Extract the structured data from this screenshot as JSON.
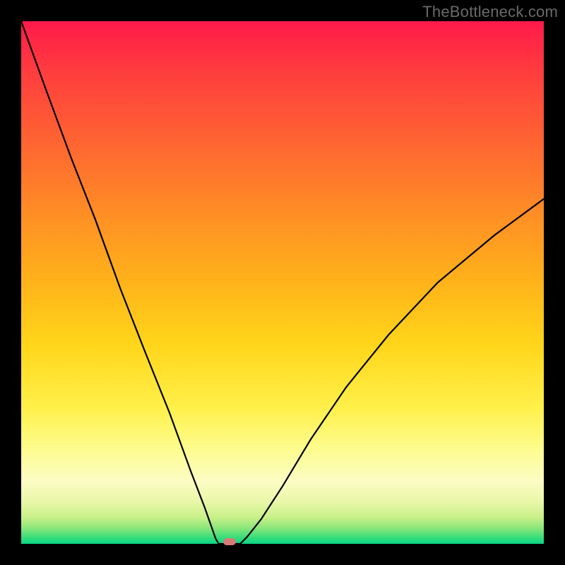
{
  "watermark": "TheBottleneck.com",
  "colors": {
    "frame": "#000000",
    "curve": "#000000",
    "marker": "#d77a78",
    "gradient_stops": [
      {
        "pos": 0,
        "color": "#ff1a4a"
      },
      {
        "pos": 10,
        "color": "#ff3e3e"
      },
      {
        "pos": 25,
        "color": "#ff6a30"
      },
      {
        "pos": 38,
        "color": "#ff9124"
      },
      {
        "pos": 50,
        "color": "#ffb31a"
      },
      {
        "pos": 62,
        "color": "#ffd61a"
      },
      {
        "pos": 74,
        "color": "#fff04a"
      },
      {
        "pos": 82,
        "color": "#fdfc8f"
      },
      {
        "pos": 88,
        "color": "#fcfcc4"
      },
      {
        "pos": 92,
        "color": "#e9f7a8"
      },
      {
        "pos": 95,
        "color": "#c8f088"
      },
      {
        "pos": 97,
        "color": "#8ae67a"
      },
      {
        "pos": 99,
        "color": "#2fdc7a"
      },
      {
        "pos": 100,
        "color": "#0bd68a"
      }
    ]
  },
  "chart_data": {
    "type": "line",
    "title": "",
    "xlabel": "",
    "ylabel": "",
    "xlim": [
      0,
      100
    ],
    "ylim": [
      0,
      100
    ],
    "grid": false,
    "legend": false,
    "series": [
      {
        "name": "left-branch",
        "x": [
          0,
          4.7,
          9.5,
          14.2,
          18.9,
          23.6,
          28.4,
          32.4,
          35.1,
          36.5,
          37.2,
          37.8
        ],
        "y": [
          100,
          87,
          74,
          62,
          49,
          37,
          25,
          14,
          7,
          3,
          1,
          0
        ]
      },
      {
        "name": "floor",
        "x": [
          37.8,
          41.9
        ],
        "y": [
          0,
          0
        ]
      },
      {
        "name": "right-branch",
        "x": [
          41.9,
          43.2,
          45.9,
          50.0,
          55.4,
          62.2,
          70.3,
          79.7,
          90.5,
          100.0
        ],
        "y": [
          0,
          1.3,
          4.7,
          11,
          20,
          30,
          40,
          50,
          59,
          66
        ]
      }
    ],
    "annotations": [
      {
        "name": "minimum-marker",
        "x": 39.9,
        "y": 0.4
      }
    ]
  }
}
